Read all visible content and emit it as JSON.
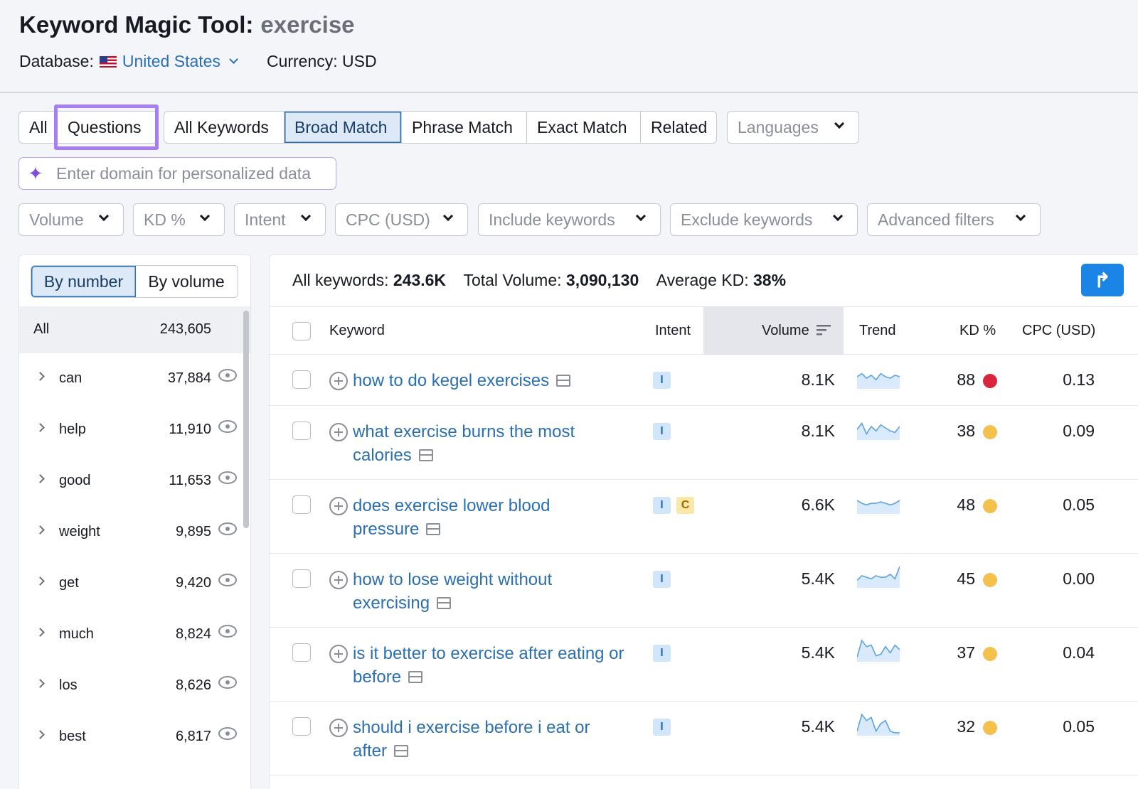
{
  "header": {
    "title": "Keyword Magic Tool:",
    "keyword": "exercise",
    "database_label": "Database:",
    "database_value": "United States",
    "currency": "Currency: USD"
  },
  "type_tabs": [
    {
      "label": "All",
      "active": false
    },
    {
      "label": "Questions",
      "active": false,
      "highlighted": true
    }
  ],
  "match_tabs": [
    {
      "label": "All Keywords",
      "active": false
    },
    {
      "label": "Broad Match",
      "active": true
    },
    {
      "label": "Phrase Match",
      "active": false
    },
    {
      "label": "Exact Match",
      "active": false
    },
    {
      "label": "Related",
      "active": false
    }
  ],
  "languages": "Languages",
  "domain_input": {
    "placeholder": "Enter domain for personalized data",
    "value": ""
  },
  "filters": [
    "Volume",
    "KD %",
    "Intent",
    "CPC (USD)",
    "Include keywords",
    "Exclude keywords",
    "Advanced filters"
  ],
  "sidebar": {
    "toggle": [
      "By number",
      "By volume"
    ],
    "all": {
      "label": "All",
      "count": "243,605"
    },
    "groups": [
      {
        "label": "can",
        "count": "37,884"
      },
      {
        "label": "help",
        "count": "11,910"
      },
      {
        "label": "good",
        "count": "11,653"
      },
      {
        "label": "weight",
        "count": "9,895"
      },
      {
        "label": "get",
        "count": "9,420"
      },
      {
        "label": "much",
        "count": "8,824"
      },
      {
        "label": "los",
        "count": "8,626"
      },
      {
        "label": "best",
        "count": "6,817"
      }
    ]
  },
  "stats": {
    "all_keywords_label": "All keywords:",
    "all_keywords_value": "243.6K",
    "total_volume_label": "Total Volume:",
    "total_volume_value": "3,090,130",
    "avg_kd_label": "Average KD:",
    "avg_kd_value": "38%"
  },
  "export_icon": "share-arrow-icon",
  "table": {
    "headers": {
      "keyword": "Keyword",
      "intent": "Intent",
      "volume": "Volume",
      "trend": "Trend",
      "kd": "KD %",
      "cpc": "CPC (USD)"
    },
    "rows": [
      {
        "keyword": "how to do kegel exercises",
        "intent": [
          "I"
        ],
        "volume": "8.1K",
        "trend": [
          7,
          9,
          6,
          8,
          5,
          9,
          7,
          6,
          8,
          7
        ],
        "kd": "88",
        "kd_color": "#d7263d",
        "cpc": "0.13"
      },
      {
        "keyword": "what exercise burns the most calories",
        "intent": [
          "I"
        ],
        "volume": "8.1K",
        "trend": [
          6,
          10,
          3,
          8,
          5,
          9,
          7,
          5,
          4,
          8
        ],
        "kd": "38",
        "kd_color": "#f2c14e",
        "cpc": "0.09"
      },
      {
        "keyword": "does exercise lower blood pressure",
        "intent": [
          "I",
          "C"
        ],
        "volume": "6.6K",
        "trend": [
          8,
          6,
          5,
          6,
          6,
          7,
          6,
          5,
          6,
          8
        ],
        "kd": "48",
        "kd_color": "#f2c14e",
        "cpc": "0.05"
      },
      {
        "keyword": "how to lose weight without exercising",
        "intent": [
          "I"
        ],
        "volume": "5.4K",
        "trend": [
          4,
          7,
          6,
          5,
          7,
          6,
          6,
          8,
          5,
          13
        ],
        "kd": "45",
        "kd_color": "#f2c14e",
        "cpc": "0.00"
      },
      {
        "keyword": "is it better to exercise after eating or before",
        "intent": [
          "I"
        ],
        "volume": "5.4K",
        "trend": [
          2,
          13,
          9,
          10,
          3,
          4,
          9,
          5,
          10,
          7
        ],
        "kd": "37",
        "kd_color": "#f2c14e",
        "cpc": "0.04"
      },
      {
        "keyword": "should i exercise before i eat or after",
        "intent": [
          "I"
        ],
        "volume": "5.4K",
        "trend": [
          2,
          13,
          9,
          11,
          2,
          7,
          9,
          2,
          1,
          1
        ],
        "kd": "32",
        "kd_color": "#f2c14e",
        "cpc": "0.05"
      }
    ]
  }
}
